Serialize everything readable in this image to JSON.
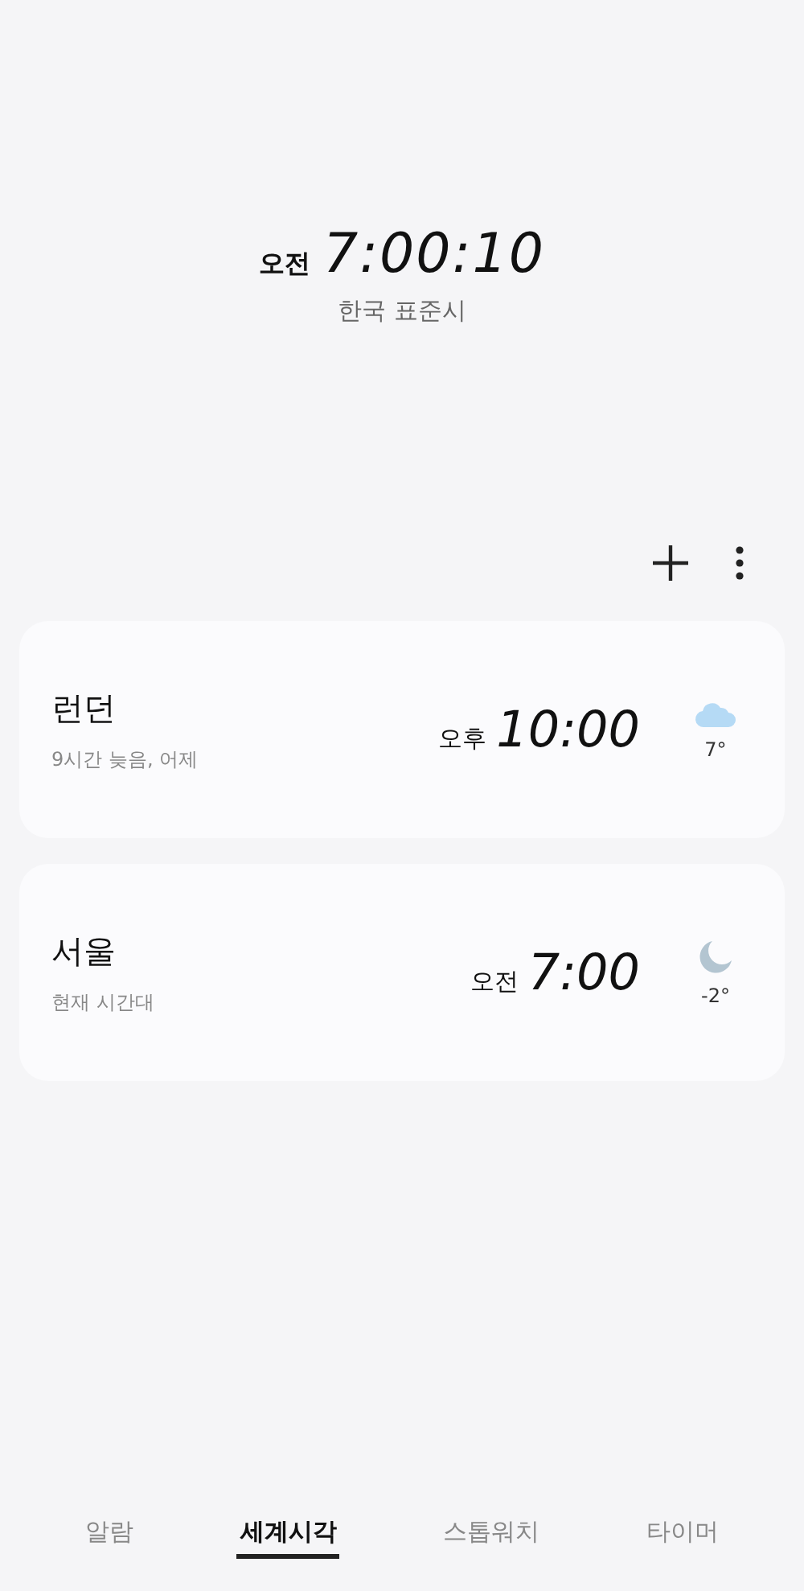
{
  "clock": {
    "ampm": "오전",
    "time": "7:00:10",
    "zone": "한국 표준시"
  },
  "cities": [
    {
      "name": "런던",
      "offset": "9시간 늦음, 어제",
      "ampm": "오후",
      "time": "10:00",
      "kind": "cloudy",
      "temp": "7°"
    },
    {
      "name": "서울",
      "offset": "현재 시간대",
      "ampm": "오전",
      "time": "7:00",
      "kind": "night",
      "temp": "-2°"
    }
  ],
  "tabs": [
    {
      "label": "알람",
      "selected": false
    },
    {
      "label": "세계시각",
      "selected": true
    },
    {
      "label": "스톱워치",
      "selected": false
    },
    {
      "label": "타이머",
      "selected": false
    }
  ]
}
